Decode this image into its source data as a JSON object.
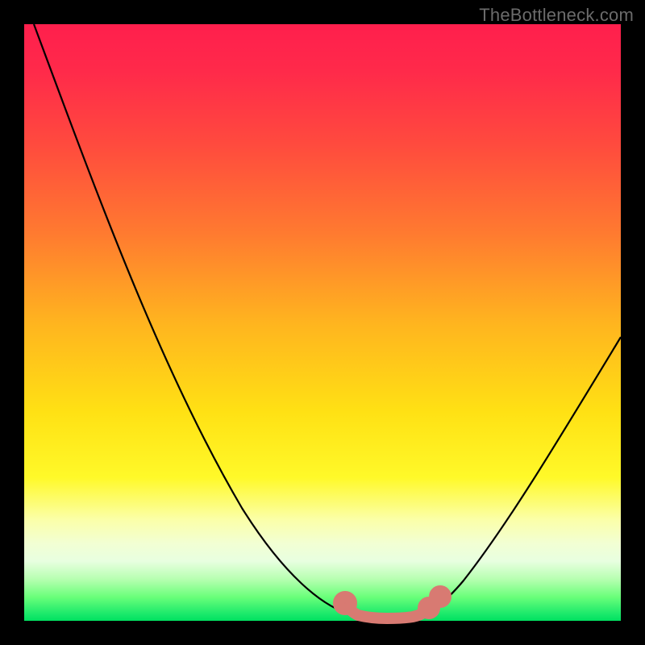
{
  "watermark": "TheBottleneck.com",
  "chart_data": {
    "type": "line",
    "title": "",
    "xlabel": "",
    "ylabel": "",
    "xlim": [
      0,
      100
    ],
    "ylim": [
      0,
      100
    ],
    "series": [
      {
        "name": "bottleneck-curve",
        "x": [
          0,
          5,
          10,
          15,
          20,
          25,
          30,
          35,
          40,
          45,
          50,
          55,
          57,
          60,
          63,
          66,
          70,
          75,
          80,
          85,
          90,
          95,
          100
        ],
        "values": [
          100,
          90,
          80,
          70,
          61,
          52,
          44,
          36,
          28,
          20,
          12,
          5,
          2,
          0,
          0,
          2,
          5,
          12,
          20,
          28,
          37,
          46,
          55
        ]
      }
    ],
    "highlight": {
      "name": "optimal-zone",
      "x": [
        55,
        57,
        59,
        61,
        63,
        65,
        67,
        69
      ],
      "values": [
        5,
        2,
        0,
        0,
        0,
        1,
        3,
        5
      ],
      "color": "#d87a72"
    },
    "gradient_stops": [
      {
        "pct": 0,
        "color": "#ff1f4d"
      },
      {
        "pct": 50,
        "color": "#ffb41f"
      },
      {
        "pct": 80,
        "color": "#fff929"
      },
      {
        "pct": 100,
        "color": "#00e060"
      }
    ]
  }
}
